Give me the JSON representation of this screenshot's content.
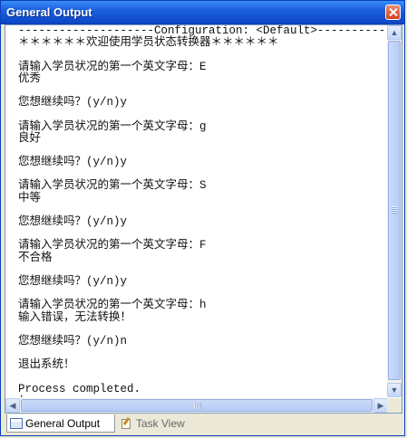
{
  "window": {
    "title": "General Output"
  },
  "output": {
    "lines": [
      "--------------------Configuration: <Default>--------------------",
      "＊＊＊＊＊＊欢迎使用学员状态转换器＊＊＊＊＊＊",
      "",
      "请输入学员状况的第一个英文字母：E",
      "优秀",
      "",
      "您想继续吗？(y/n)y",
      "",
      "请输入学员状况的第一个英文字母：g",
      "良好",
      "",
      "您想继续吗？(y/n)y",
      "",
      "请输入学员状况的第一个英文字母：S",
      "中等",
      "",
      "您想继续吗？(y/n)y",
      "",
      "请输入学员状况的第一个英文字母：F",
      "不合格",
      "",
      "您想继续吗？(y/n)y",
      "",
      "请输入学员状况的第一个英文字母：h",
      "输入错误，无法转换！",
      "",
      "您想继续吗？(y/n)n",
      "",
      "退出系统！",
      "",
      "Process completed.",
      "|"
    ]
  },
  "icons": {
    "close": "close-icon",
    "scroll_up": "arrow-up-icon",
    "scroll_down": "arrow-down-icon",
    "scroll_left": "arrow-left-icon",
    "scroll_right": "arrow-right-icon",
    "general_output": "output-window-icon",
    "task_view": "task-pencil-icon"
  },
  "tabs": [
    {
      "label": "General Output"
    },
    {
      "label": "Task View"
    }
  ],
  "colors": {
    "titlebar": "#1a5fde",
    "close_button": "#d5421c",
    "scrollbar_thumb": "#b6cbf6"
  }
}
